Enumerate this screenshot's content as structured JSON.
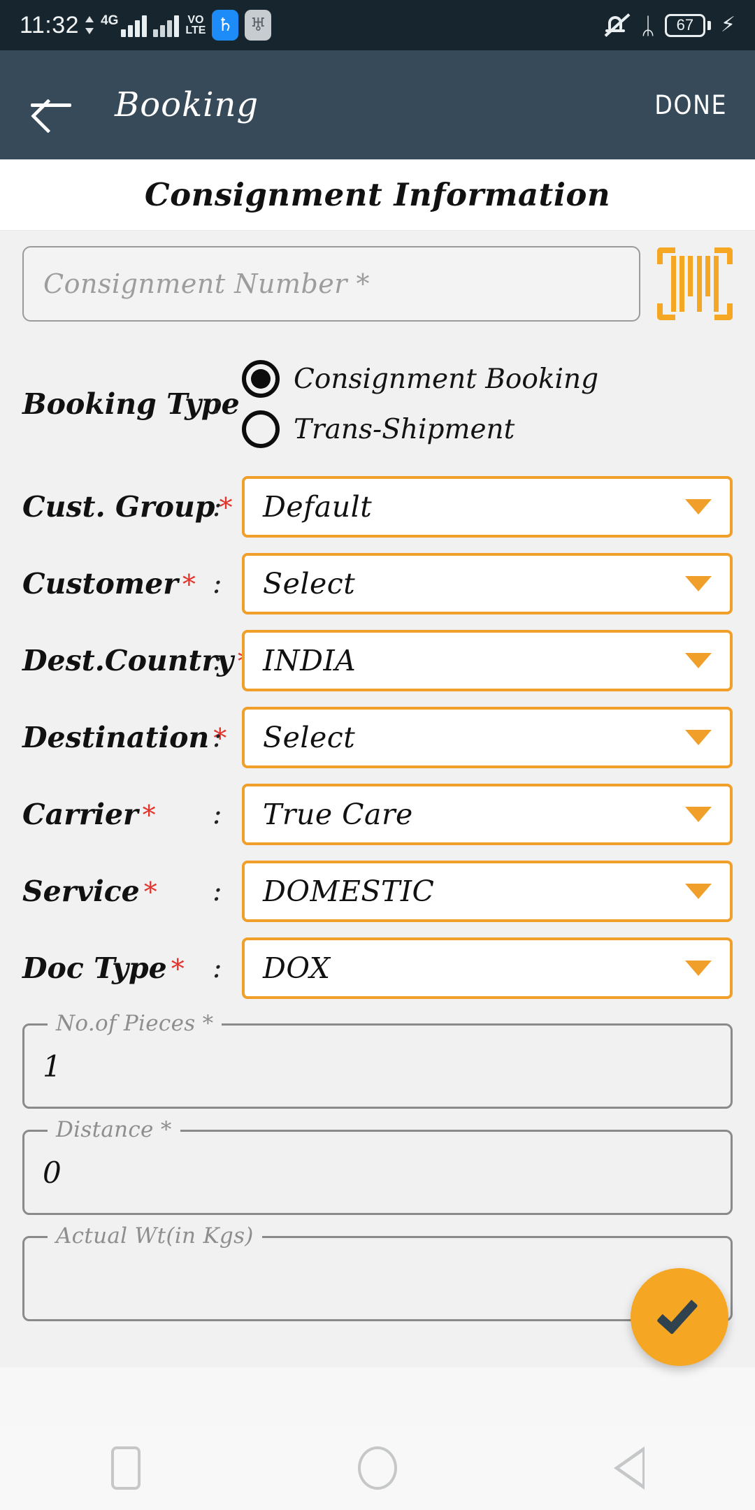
{
  "status_bar": {
    "time": "11:32",
    "network_gen": "4G",
    "volte_line1": "VO",
    "volte_line2": "LTE",
    "usb_icon": "usb-icon",
    "android_icon": "android-share-icon",
    "mute_icon": "bell-muted-icon",
    "bluetooth_icon": "bluetooth-icon",
    "bluetooth_glyph": "ᛦ",
    "battery_percent": "67",
    "charging_glyph": "⚡"
  },
  "app_bar": {
    "back_icon": "back-arrow-icon",
    "title": "Booking",
    "done_label": "DONE",
    "background": "#374a5a"
  },
  "section": {
    "title": "Consignment Information"
  },
  "consignment": {
    "placeholder": "Consignment Number *",
    "value": "",
    "scan_icon": "barcode-scan-icon",
    "scan_color": "#f5a623"
  },
  "booking_type": {
    "label": "Booking Type",
    "colon": ":",
    "options": [
      {
        "label": "Consignment Booking",
        "selected": true
      },
      {
        "label": "Trans-Shipment",
        "selected": false
      }
    ]
  },
  "dropdowns": [
    {
      "label": "Cust. Group",
      "required": "*",
      "colon": ":",
      "value": "Default"
    },
    {
      "label": "Customer",
      "required": "*",
      "colon": ":",
      "value": "Select"
    },
    {
      "label": "Dest.Country",
      "required": "*",
      "colon": ":",
      "value": "INDIA"
    },
    {
      "label": "Destination",
      "required": "*",
      "colon": ":",
      "value": "Select"
    },
    {
      "label": "Carrier",
      "required": "*",
      "colon": ":",
      "value": "True Care"
    },
    {
      "label": "Service",
      "required": "*",
      "colon": ":",
      "value": "DOMESTIC"
    },
    {
      "label": "Doc Type",
      "required": "*",
      "colon": ":",
      "value": "DOX"
    }
  ],
  "text_fields": [
    {
      "label": "No.of Pieces *",
      "value": "1"
    },
    {
      "label": "Distance *",
      "value": "0"
    },
    {
      "label": "Actual  Wt(in Kgs)",
      "value": ""
    }
  ],
  "fab": {
    "icon": "check-icon",
    "color": "#f5a623"
  },
  "nav_bar": {
    "recents_icon": "square-recents-icon",
    "home_icon": "circle-home-icon",
    "back_icon": "triangle-back-icon"
  },
  "colors": {
    "accent": "#f0a02a",
    "app_bar": "#374a5a",
    "status_bar": "#17262e",
    "required_red": "#e2342c",
    "page_bg": "#f1f1f1"
  }
}
